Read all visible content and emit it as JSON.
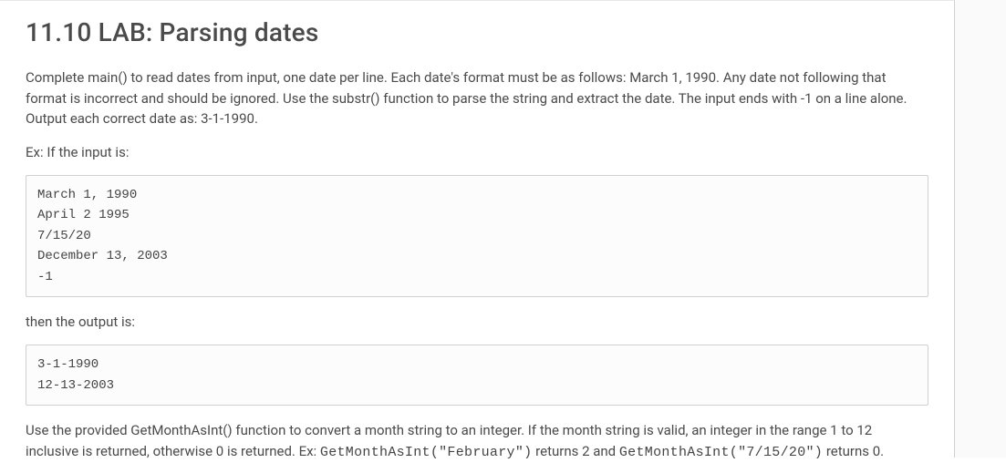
{
  "header": {
    "title": "11.10 LAB: Parsing dates"
  },
  "body": {
    "intro": "Complete main() to read dates from input, one date per line. Each date's format must be as follows: March 1, 1990. Any date not following that format is incorrect and should be ignored. Use the substr() function to parse the string and extract the date. The input ends with -1 on a line alone. Output each correct date as: 3-1-1990.",
    "example_label": "Ex: If the input is:",
    "input_block": "March 1, 1990\nApril 2 1995\n7/15/20\nDecember 13, 2003\n-1",
    "then_label": "then the output is:",
    "output_block": "3-1-1990\n12-13-2003",
    "footer_pre": "Use the provided GetMonthAsInt() function to convert a month string to an integer. If the month string is valid, an integer in the range 1 to 12 inclusive is returned, otherwise 0 is returned. Ex: ",
    "footer_code1": "GetMonthAsInt(\"February\")",
    "footer_mid": " returns 2 and ",
    "footer_code2": "GetMonthAsInt(\"7/15/20\")",
    "footer_post": " returns 0."
  }
}
